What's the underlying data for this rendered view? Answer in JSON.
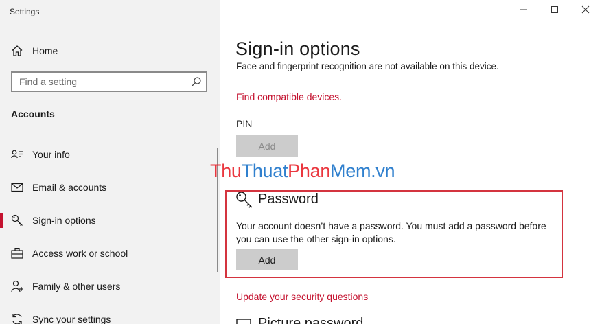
{
  "window": {
    "title": "Settings",
    "controls": [
      "minimize-icon",
      "maximize-icon",
      "close-icon"
    ]
  },
  "sidebar": {
    "home_label": "Home",
    "search_placeholder": "Find a setting",
    "section_heading": "Accounts",
    "items": [
      {
        "label": "Your info",
        "icon": "your-info-icon"
      },
      {
        "label": "Email & accounts",
        "icon": "email-icon"
      },
      {
        "label": "Sign-in options",
        "icon": "key-icon",
        "active": true
      },
      {
        "label": "Access work or school",
        "icon": "briefcase-icon"
      },
      {
        "label": "Family & other users",
        "icon": "family-icon"
      },
      {
        "label": "Sync your settings",
        "icon": "sync-icon"
      }
    ]
  },
  "main": {
    "title": "Sign-in options",
    "face_notice": "Face and fingerprint recognition are not available on this device.",
    "find_devices_link": "Find compatible devices.",
    "pin": {
      "label": "PIN",
      "button_label": "Add"
    },
    "watermark": {
      "part1": "Thu",
      "part2": "Thuat",
      "part3": "Phan",
      "part4": "Mem",
      "part5": ".vn"
    },
    "password": {
      "title": "Password",
      "description": "Your account doesn’t have a password. You must add a password before you can use the other sign-in options.",
      "button_label": "Add"
    },
    "security_questions_link": "Update your security questions",
    "picture_password_title": "Picture password"
  },
  "colors": {
    "accent": "#c4122f",
    "sidebar_bg": "#f2f2f2",
    "highlight_border": "#d4343f",
    "watermark_red": "#e8222b",
    "watermark_blue": "#1a73c9"
  }
}
